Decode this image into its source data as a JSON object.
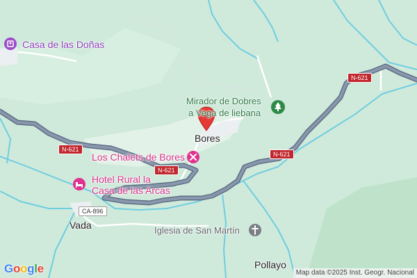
{
  "places": {
    "casa_donas": "Casa de las Doñas",
    "mirador_line1": "Mirador de Dobres",
    "mirador_line2": "a Vega de liebana",
    "chalets": "Los Chalets de Bores",
    "hotel_line1": "Hotel Rural la",
    "hotel_line2": "Casa de las Arcas",
    "iglesia": "Iglesia de San Martín"
  },
  "towns": {
    "bores": "Bores",
    "vada": "Vada",
    "pollayo": "Pollayo"
  },
  "roads": {
    "n621": "N-621",
    "ca896": "CA-896"
  },
  "icons": {
    "lodging": "lodging-icon",
    "viewpoint": "tree-icon",
    "chalet": "tools-icon",
    "hotel": "bed-icon",
    "church": "cross-icon",
    "pin": "map-pin-icon"
  },
  "colors": {
    "land": "#cfeadb",
    "water": "#6fcde0",
    "highway": "#8090a6",
    "pin": "#e53935"
  },
  "brand": {
    "logo": "Google"
  },
  "attribution": "Map data ©2025 Inst. Geogr. Nacional"
}
